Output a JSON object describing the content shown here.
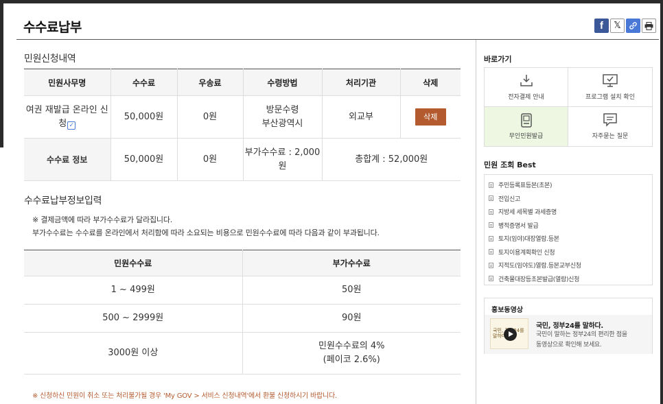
{
  "page": {
    "title": "수수료납부"
  },
  "share": {
    "facebook": "f",
    "x": "𝕏"
  },
  "application": {
    "title": "민원신청내역",
    "headers": [
      "민원사무명",
      "수수료",
      "우송료",
      "수령방법",
      "처리기관",
      "삭제"
    ],
    "row": {
      "name_line1": "여권 재발급 온라인 신",
      "name_line2": "청",
      "fee": "50,000원",
      "postage": "0원",
      "receipt_line1": "방문수령",
      "receipt_line2": "부산광역시",
      "agency": "외교부",
      "delete_label": "삭제"
    },
    "fee_info": {
      "label": "수수료 정보",
      "fee": "50,000원",
      "postage": "0원",
      "vat_line1": "부가수수료 : 2,000",
      "vat_line2": "원",
      "total": "총합계 : 52,000원"
    }
  },
  "payment_info": {
    "title": "수수료납부정보입력",
    "note1": "※ 결제금액에 따라 부가수수료가 달라집니다.",
    "note2": "부가수수료는 수수료를 온라인에서 처리함에 따라 소요되는 비용으로 민원수수료에 따라 다음과 같이 부과됩니다.",
    "headers": [
      "민원수수료",
      "부가수수료"
    ],
    "rows": [
      {
        "range": "1 ~ 499원",
        "fee": "50원"
      },
      {
        "range": "500 ~ 2999원",
        "fee": "90원"
      },
      {
        "range": "3000원 이상",
        "fee_line1": "민원수수료의 4%",
        "fee_line2": "(페이코 2.6%)"
      }
    ],
    "footnote": "※ 신청하신 민원이 취소 또는 처리불가될 경우 'My GOV > 서비스 신청내역'에서 환불 신청하시기 바랍니다."
  },
  "sidebar": {
    "shortcuts_title": "바로가기",
    "shortcuts": [
      {
        "label": "전자결제 안내",
        "icon": "download-icon"
      },
      {
        "label": "프로그램 설치 확인",
        "icon": "monitor-check-icon"
      },
      {
        "label": "무인민원발급",
        "icon": "kiosk-icon"
      },
      {
        "label": "자주묻는 질문",
        "icon": "chat-icon"
      }
    ],
    "best_title": "민원 조회 Best",
    "best_items": [
      "주민등록표등본(초본)",
      "전입신고",
      "지방세 세목별 과세증명",
      "병적증명서 발급",
      "토지(임야)대장열람.등본",
      "토지이용계획확인 신청",
      "지적도(임야도)열람.등본교부신청",
      "건축물대장등초본발급(열람)신청"
    ],
    "promo": {
      "title": "홍보동영상",
      "thumb_text": "국민, 정부24를 말하다",
      "headline": "국민, 정부24를 말하다.",
      "text_line1": "국민이 말하는 정부24의 편리한 점을",
      "text_line2": "동영상으로 확인해 보세요."
    }
  },
  "colors": {
    "delete_button": "#b35a2e",
    "active_tile": "#eef7e2",
    "facebook": "#3b5998",
    "link": "#4a78d6"
  }
}
